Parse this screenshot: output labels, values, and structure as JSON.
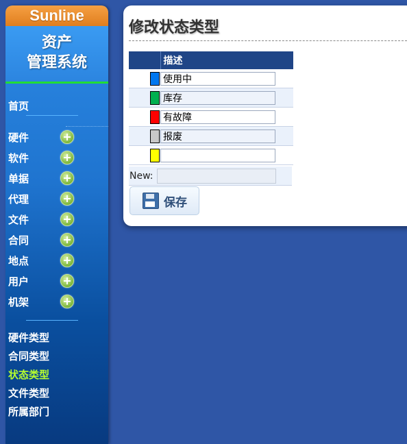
{
  "sidebar": {
    "brand": "Sunline",
    "app_title_line1": "资产",
    "app_title_line2": "管理系统",
    "home": "首页",
    "nav_items": [
      "硬件",
      "软件",
      "单据",
      "代理",
      "文件",
      "合同",
      "地点",
      "用户",
      "机架"
    ],
    "type_items": [
      "硬件类型",
      "合同类型",
      "状态类型",
      "文件类型",
      "所属部门"
    ],
    "active_type": "状态类型"
  },
  "main": {
    "title": "修改状态类型",
    "table_header_desc": "描述",
    "rows": [
      {
        "color": "#0077ee",
        "value": "使用中"
      },
      {
        "color": "#00b050",
        "value": "库存"
      },
      {
        "color": "#ff0000",
        "value": "有故障"
      },
      {
        "color": "#c8c8c8",
        "value": "报废"
      },
      {
        "color": "#ffff00",
        "value": ""
      }
    ],
    "new_label": "New:",
    "new_value": "",
    "save_label": "保存"
  }
}
